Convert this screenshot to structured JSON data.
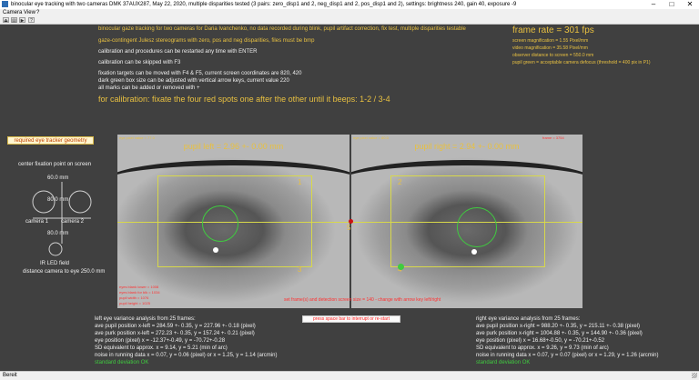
{
  "window": {
    "title": "binocular eye tracking with two cameras DMK 37AUX287, May 22, 2020, multiple disparities tested (3 pairs: zero_disp1 and 2, neg_disp1 and 2, pos_disp1 and 2), settings: brightness 240, gain 40, exposure -9",
    "minimize": "–",
    "maximize": "□",
    "close": "✕"
  },
  "menu": [
    "Camera",
    "View",
    "?"
  ],
  "toolbar": {
    "buttons": [
      "⏏",
      "▤",
      "▶",
      "?"
    ]
  },
  "status": {
    "text": "Bereit"
  },
  "info": {
    "lines": [
      "binocular gaze tracking for two cameras for Daria Ivanchenko, no data recorded during blink, pupil artifact correction, fix test, multiple disparities testable",
      "gaze-contingent Julesz stereograms with zero, pos and neg disparities, files must be bmp",
      "calibration and procedures can be restarted any time with ENTER",
      "calibration can be skipped with F3",
      "fixation targets can be moved with F4 & F5, current screen coordinates are 820, 420",
      "dark green box size can be adjusted with vertical arrow keys, current value 220",
      "all marks can be added or removed with +"
    ],
    "calibration_instruction": "for calibration: fixate the four red spots one after the other until it beeps: 1-2 / 3-4"
  },
  "stats": {
    "frame_rate": "frame rate = 301 fps",
    "lines": [
      "screen magnification = 1.55 Pixel/mm",
      "video magnification = 35.58 Pixel/mm",
      "observer distance to screen = 550.0 mm",
      "pupil green = acceptable camera defocus (threshold = 400 pix in P1)"
    ]
  },
  "geometry": {
    "button": "required eye tracker geometry",
    "center_label": "center fixation point on screen",
    "dist_top": "60.0 mm",
    "dist_mid": "80.0 mm",
    "camera1": "camera 1",
    "camera2": "camera 2",
    "dist_bottom": "80.0 mm",
    "ir_label": "IR LED field",
    "distance": "distance camera to eye 250.0 mm"
  },
  "eyes": {
    "left": {
      "pupil_label": "pupil left = 2.96 +- 0.00 mm",
      "corner_label": "eye pixel value = 77.0",
      "bottom_lines": [
        "eyes blank lower = 1008",
        "eyes blank for blk = 1034",
        "pupil width = 1076",
        "pupil height = 1025"
      ]
    },
    "right": {
      "pupil_label": "pupil right = 2.94 +- 0.00 mm",
      "corner_label": "eye pixel value = 80.0",
      "frame_label": "frame = 3754"
    },
    "center_marker": "5",
    "numbers_left": [
      "1",
      "3"
    ],
    "numbers_right": [
      "2",
      "4"
    ],
    "red_notice": "set frame(s) and detection screen size = 140 - change with arrow key left/right"
  },
  "space_button": "press space bar to interrupt or re-start",
  "left_stats": {
    "title": "left eye variance analysis from 25 frames:",
    "lines": [
      "ave pupil position x-left = 284.59 +- 0.35, y = 227.96 +- 0.18  (pixel)",
      "ave purk position x-left = 272.23 +- 0.35, y = 157.24 +- 0.21 (pixel)",
      "eye position (pixel) x = -12.37+-0.49, y = -70.72+-0.28",
      "SD equivalent to approx. x = 9.14, y = 5.21 (min of arc)",
      "noise in running data x = 0.07, y = 0.06 (pixel) or x = 1.25, y = 1.14 (arcmin)"
    ],
    "ok": "standard deviation OK"
  },
  "right_stats": {
    "title": "right eye variance analysis from 25 frames:",
    "lines": [
      "ave pupil position x-right = 988.20 +- 0.35, y = 215.11 +- 0.38  (pixel)",
      "ave purk position x-right = 1004.88 +- 0.35, y = 144.90 +- 0.36 (pixel)",
      "eye position (pixel) x = 16.68+-0.50, y = -70.21+-0.52",
      "SD equivalent to approx. x = 9.26, y = 9.73 (min of arc)",
      "noise in running data x = 0.07, y = 0.07 (pixel) or x = 1.29, y = 1.26 (arcmin)"
    ],
    "ok": "standard deviation OK"
  }
}
